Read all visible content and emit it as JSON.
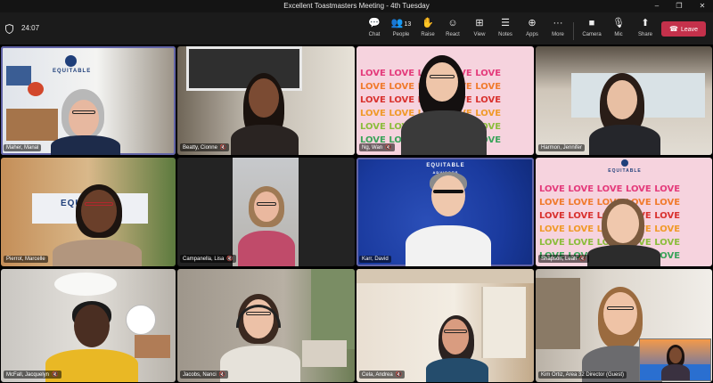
{
  "window": {
    "title": "Excellent Toastmasters Meeting - 4th Tuesday",
    "controls": [
      "–",
      "❐",
      "✕"
    ]
  },
  "toolbar": {
    "timer": "24:07",
    "buttons": [
      {
        "label": "Chat",
        "icon": "chat-icon",
        "glyph": "💬"
      },
      {
        "label": "People",
        "icon": "people-icon",
        "glyph": "👥",
        "count": "13"
      },
      {
        "label": "Raise",
        "icon": "raise-hand-icon",
        "glyph": "✋"
      },
      {
        "label": "React",
        "icon": "react-icon",
        "glyph": "☺"
      },
      {
        "label": "View",
        "icon": "view-icon",
        "glyph": "⊞"
      },
      {
        "label": "Notes",
        "icon": "notes-icon",
        "glyph": "☰"
      },
      {
        "label": "Apps",
        "icon": "apps-icon",
        "glyph": "⊕"
      },
      {
        "label": "More",
        "icon": "more-icon",
        "glyph": "···"
      },
      {
        "label": "Camera",
        "icon": "camera-icon",
        "glyph": "■"
      },
      {
        "label": "Mic",
        "icon": "mic-icon",
        "glyph": "🎙"
      },
      {
        "label": "Share",
        "icon": "share-icon",
        "glyph": "⬆"
      }
    ],
    "leave_label": "Leave"
  },
  "participants": [
    {
      "name": "Maher, Manal"
    },
    {
      "name": "Beatty, Cionne"
    },
    {
      "name": "Ng, Wan"
    },
    {
      "name": "Harmon, Jennifer"
    },
    {
      "name": "Pierrot, Marcelle"
    },
    {
      "name": "Campanella, Lisa"
    },
    {
      "name": "Karr, David"
    },
    {
      "name": "Shapson, Leah"
    },
    {
      "name": "McFall, Jacquelyn"
    },
    {
      "name": "Jacobs, Nanci"
    },
    {
      "name": "Cela, Andrea"
    },
    {
      "name": "Kim Ortiz, Area 32 Director (Guest)"
    }
  ],
  "backgrounds": {
    "love_word": "LOVE",
    "equitable_name": "EQUITABLE",
    "equitable_sub": "ADVISORS"
  },
  "colors": {
    "leave": "#c4314b",
    "active_speaker": "#6264a7"
  }
}
